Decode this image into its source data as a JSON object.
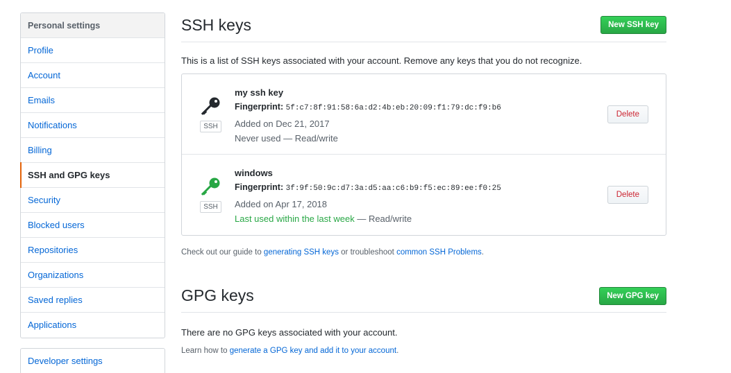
{
  "sidebar": {
    "heading": "Personal settings",
    "items": [
      {
        "label": "Profile"
      },
      {
        "label": "Account"
      },
      {
        "label": "Emails"
      },
      {
        "label": "Notifications"
      },
      {
        "label": "Billing"
      },
      {
        "label": "SSH and GPG keys"
      },
      {
        "label": "Security"
      },
      {
        "label": "Blocked users"
      },
      {
        "label": "Repositories"
      },
      {
        "label": "Organizations"
      },
      {
        "label": "Saved replies"
      },
      {
        "label": "Applications"
      }
    ],
    "developer": "Developer settings"
  },
  "ssh": {
    "title": "SSH keys",
    "new_button": "New SSH key",
    "intro": "This is a list of SSH keys associated with your account. Remove any keys that you do not recognize.",
    "keys": [
      {
        "name": "my ssh key",
        "fingerprint_label": "Fingerprint:",
        "fingerprint": "5f:c7:8f:91:58:6a:d2:4b:eb:20:09:f1:79:dc:f9:b6",
        "added": "Added on Dec 21, 2017",
        "usage": "Never used",
        "access": " — Read/write",
        "badge": "SSH",
        "delete": "Delete",
        "icon": "key-icon",
        "icon_color": "#24292e"
      },
      {
        "name": "windows",
        "fingerprint_label": "Fingerprint:",
        "fingerprint": "3f:9f:50:9c:d7:3a:d5:aa:c6:b9:f5:ec:89:ee:f0:25",
        "added": "Added on Apr 17, 2018",
        "usage": "Last used within the last week",
        "access": " — Read/write",
        "badge": "SSH",
        "delete": "Delete",
        "icon": "key-icon",
        "icon_color": "#28a745"
      }
    ],
    "guide": {
      "prefix": "Check out our guide to ",
      "link1": "generating SSH keys",
      "middle": " or troubleshoot ",
      "link2": "common SSH Problems",
      "suffix": "."
    }
  },
  "gpg": {
    "title": "GPG keys",
    "new_button": "New GPG key",
    "empty": "There are no GPG keys associated with your account.",
    "learn": {
      "prefix": "Learn how to ",
      "link": "generate a GPG key and add it to your account",
      "suffix": "."
    }
  },
  "colors": {
    "accent_selected": "#e36209",
    "link": "#0366d6",
    "primary_button": "#28a745",
    "danger_text": "#cb2431"
  }
}
